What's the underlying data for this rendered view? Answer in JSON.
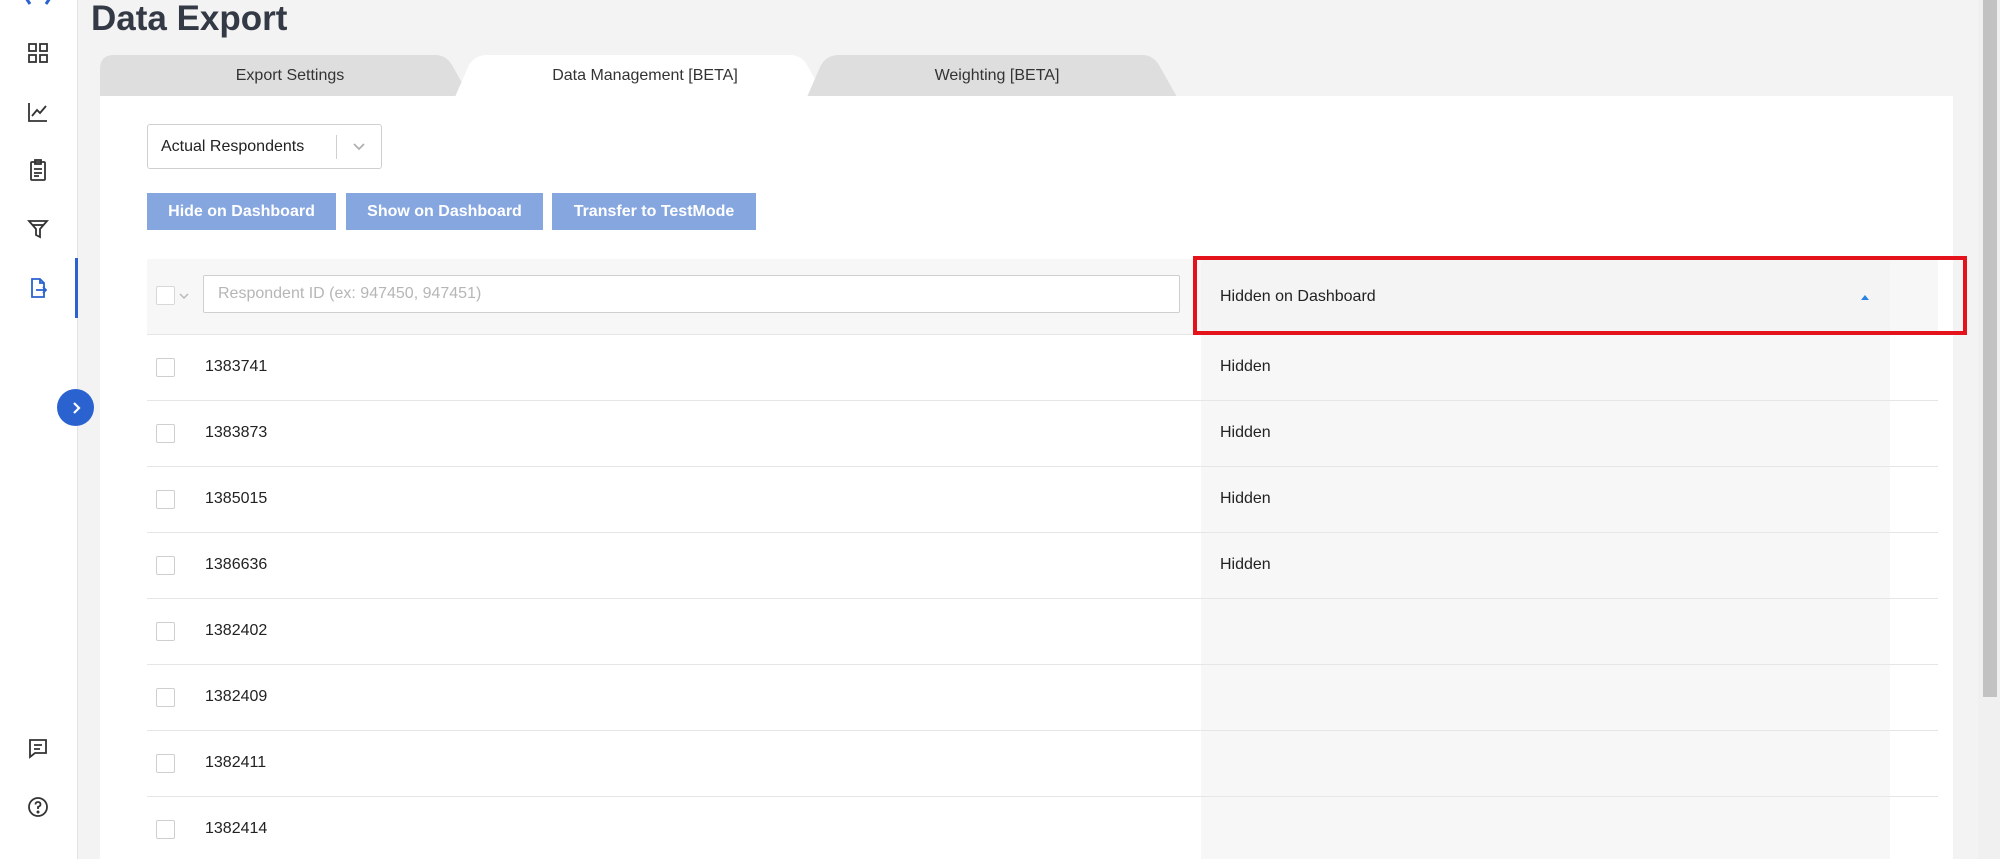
{
  "page": {
    "title": "Data Export"
  },
  "sidebar": {
    "items": [
      {
        "icon": "dashboard-grid-icon"
      },
      {
        "icon": "line-chart-icon"
      },
      {
        "icon": "clipboard-icon"
      },
      {
        "icon": "filter-icon"
      },
      {
        "icon": "data-export-icon",
        "active": true
      },
      {
        "icon": "comment-icon"
      },
      {
        "icon": "help-icon"
      }
    ],
    "accent_color": "#2a62d0"
  },
  "tabs": [
    {
      "label": "Export Settings",
      "active": false
    },
    {
      "label": "Data Management [BETA]",
      "active": true
    },
    {
      "label": "Weighting [BETA]",
      "active": false
    }
  ],
  "filter": {
    "respondent_type": "Actual Respondents"
  },
  "actions": {
    "hide_label": "Hide on Dashboard",
    "show_label": "Show on Dashboard",
    "transfer_label": "Transfer to TestMode",
    "button_color": "#86a6e0"
  },
  "table": {
    "search_placeholder": "Respondent ID (ex: 947450, 947451)",
    "column_header": "Hidden on Dashboard",
    "sort": "ascending",
    "rows": [
      {
        "id": "1383741",
        "status": "Hidden"
      },
      {
        "id": "1383873",
        "status": "Hidden"
      },
      {
        "id": "1385015",
        "status": "Hidden"
      },
      {
        "id": "1386636",
        "status": "Hidden"
      },
      {
        "id": "1382402",
        "status": ""
      },
      {
        "id": "1382409",
        "status": ""
      },
      {
        "id": "1382411",
        "status": ""
      },
      {
        "id": "1382414",
        "status": ""
      }
    ]
  },
  "annotation": {
    "highlight_color": "#e3121b"
  }
}
